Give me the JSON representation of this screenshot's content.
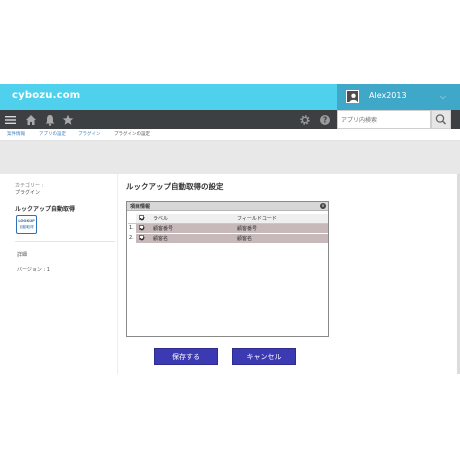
{
  "header": {
    "logo": "cybozu.com",
    "username": "Alex2013",
    "user_chevron": "⌵"
  },
  "nav": {
    "search_placeholder": "アプリ内検索",
    "icons": [
      "menu-icon",
      "home-icon",
      "bell-icon",
      "star-icon",
      "gear-icon",
      "help-icon",
      "search-icon"
    ]
  },
  "breadcrumb": [
    "案件情報",
    "アプリの設定",
    "プラグイン",
    "プラグインの設定"
  ],
  "sidebar": {
    "category_label": "カテゴリー :",
    "category_value": "プラグイン",
    "plugin_name": "ルックアップ自動取得",
    "logo_line1": "LOOKUP",
    "logo_line2": "自動取得",
    "detail": "詳細",
    "version": "バージョン : 1"
  },
  "main": {
    "title": "ルックアップ自動取得の設定",
    "panel_title": "項目情報",
    "columns": [
      "ラベル",
      "フィールドコード"
    ],
    "rows": [
      {
        "num": "1.",
        "label": "顧客番号",
        "code": "顧客番号"
      },
      {
        "num": "2.",
        "label": "顧客名",
        "code": "顧客名"
      }
    ],
    "save_label": "保存する",
    "cancel_label": "キャンセル"
  },
  "colors": {
    "header": "#4fd0ec",
    "navbar": "#3d4042",
    "button": "#3c3ab2",
    "row_bg": "#c7b9b9"
  }
}
